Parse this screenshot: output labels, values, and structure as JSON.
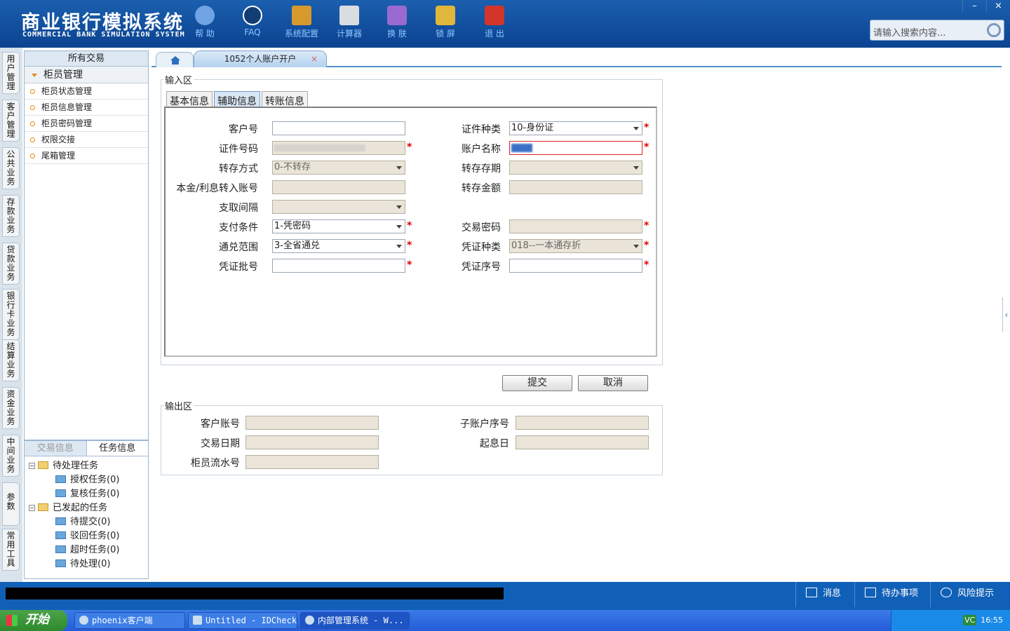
{
  "app": {
    "title_cn": "商业银行模拟系统",
    "title_en": "COMMERCIAL BANK SIMULATION SYSTEM",
    "window_controls": [
      "–",
      "×"
    ]
  },
  "toolbar": [
    {
      "label": "帮 助",
      "icon": "info-icon",
      "color": "#6fa3e3"
    },
    {
      "label": "FAQ",
      "icon": "question-icon",
      "color": "#123e73"
    },
    {
      "label": "系统配置",
      "icon": "toolbox-icon",
      "color": "#d69a2c"
    },
    {
      "label": "计算器",
      "icon": "calculator-icon",
      "color": "#d9dde2"
    },
    {
      "label": "换 肤",
      "icon": "shirt-icon",
      "color": "#9a6ad0"
    },
    {
      "label": "锁 屏",
      "icon": "lock-icon",
      "color": "#e0b63b"
    },
    {
      "label": "退 出",
      "icon": "power-icon",
      "color": "#d2352a"
    }
  ],
  "search": {
    "placeholder": "请输入搜索内容..."
  },
  "left_tabs": [
    "用户管理",
    "客户管理",
    "公共业务",
    "存款业务",
    "贷款业务",
    "银行卡业务",
    "结算业务",
    "资金业务",
    "中间业务",
    "参数",
    "常用工具"
  ],
  "nav": {
    "header": "所有交易",
    "group": "柜员管理",
    "items": [
      "柜员状态管理",
      "柜员信息管理",
      "柜员密码管理",
      "权限交接",
      "尾箱管理"
    ]
  },
  "task_panel": {
    "tabs": [
      "交易信息",
      "任务信息"
    ],
    "tree": [
      {
        "label": "待处理任务",
        "level": 0
      },
      {
        "label": "授权任务(0)",
        "level": 1
      },
      {
        "label": "复核任务(0)",
        "level": 1
      },
      {
        "label": "已发起的任务",
        "level": 0
      },
      {
        "label": "待提交(0)",
        "level": 1
      },
      {
        "label": "驳回任务(0)",
        "level": 1
      },
      {
        "label": "超时任务(0)",
        "level": 1
      },
      {
        "label": "待处理(0)",
        "level": 1
      }
    ]
  },
  "tabs": {
    "active": "1052个人账户开户",
    "close": "×"
  },
  "input_area": {
    "legend": "输入区",
    "subtabs": [
      "基本信息",
      "辅助信息",
      "转账信息"
    ],
    "fields": {
      "kehuhao": {
        "label": "客户号",
        "value": ""
      },
      "zjzl": {
        "label": "证件种类",
        "value": "10-身份证"
      },
      "zjhm": {
        "label": "证件号码",
        "value": ""
      },
      "zhmc": {
        "label": "账户名称",
        "value": ""
      },
      "zcfs": {
        "label": "转存方式",
        "value": "0-不转存"
      },
      "zcqq": {
        "label": "转存存期",
        "value": ""
      },
      "bjzh": {
        "label": "本金/利息转入账号",
        "value": ""
      },
      "zcje": {
        "label": "转存金额",
        "value": ""
      },
      "zqjg": {
        "label": "支取间隔",
        "value": ""
      },
      "zftj": {
        "label": "支付条件",
        "value": "1-凭密码"
      },
      "jymm": {
        "label": "交易密码",
        "value": ""
      },
      "tdfw": {
        "label": "通兑范围",
        "value": "3-全省通兑"
      },
      "pzzl": {
        "label": "凭证种类",
        "value": "018--一本通存折"
      },
      "pzph": {
        "label": "凭证批号",
        "value": ""
      },
      "pzxh": {
        "label": "凭证序号",
        "value": ""
      }
    },
    "required_mark": "*"
  },
  "buttons": {
    "submit": "提交",
    "cancel": "取消"
  },
  "output_area": {
    "legend": "输出区",
    "fields": {
      "khzh": "客户账号",
      "zzhxh": "子账户序号",
      "jyrq": "交易日期",
      "qxr": "起息日",
      "gylsh": "柜员流水号"
    }
  },
  "statusbar": {
    "msg": "消息",
    "todo": "待办事项",
    "risk": "风险提示"
  },
  "taskbar": {
    "start": "开始",
    "tasks": [
      "phoenix客户端",
      "Untitled - IDCheck",
      "内部管理系统 - W..."
    ],
    "clock": "16:55",
    "tray_text": "VC"
  }
}
